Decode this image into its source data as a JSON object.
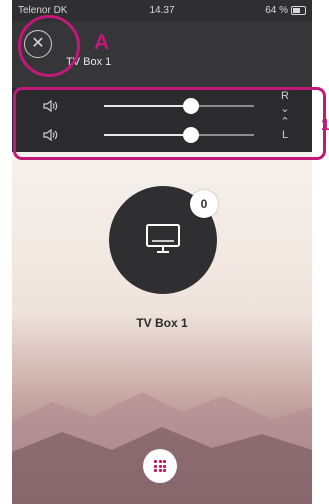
{
  "status_bar": {
    "carrier": "Telenor DK",
    "time": "14.37",
    "battery": "64 %",
    "battery_level": 0.64
  },
  "header": {
    "device_title": "TV Box 1",
    "close_icon": "close-icon"
  },
  "volume": {
    "rows": [
      {
        "name": "right",
        "level": 0.58
      },
      {
        "name": "left",
        "level": 0.58
      }
    ],
    "balance": {
      "top": "R",
      "bottom": "L"
    }
  },
  "device": {
    "name": "TV Box 1",
    "count": "0",
    "icon": "tv-icon"
  },
  "menu_button": {
    "icon": "grid-icon"
  },
  "annotations": {
    "a": "A",
    "one": "1",
    "color": "#c2187a"
  },
  "colors": {
    "accent": "#c2185b",
    "header_bg": "#363638"
  }
}
